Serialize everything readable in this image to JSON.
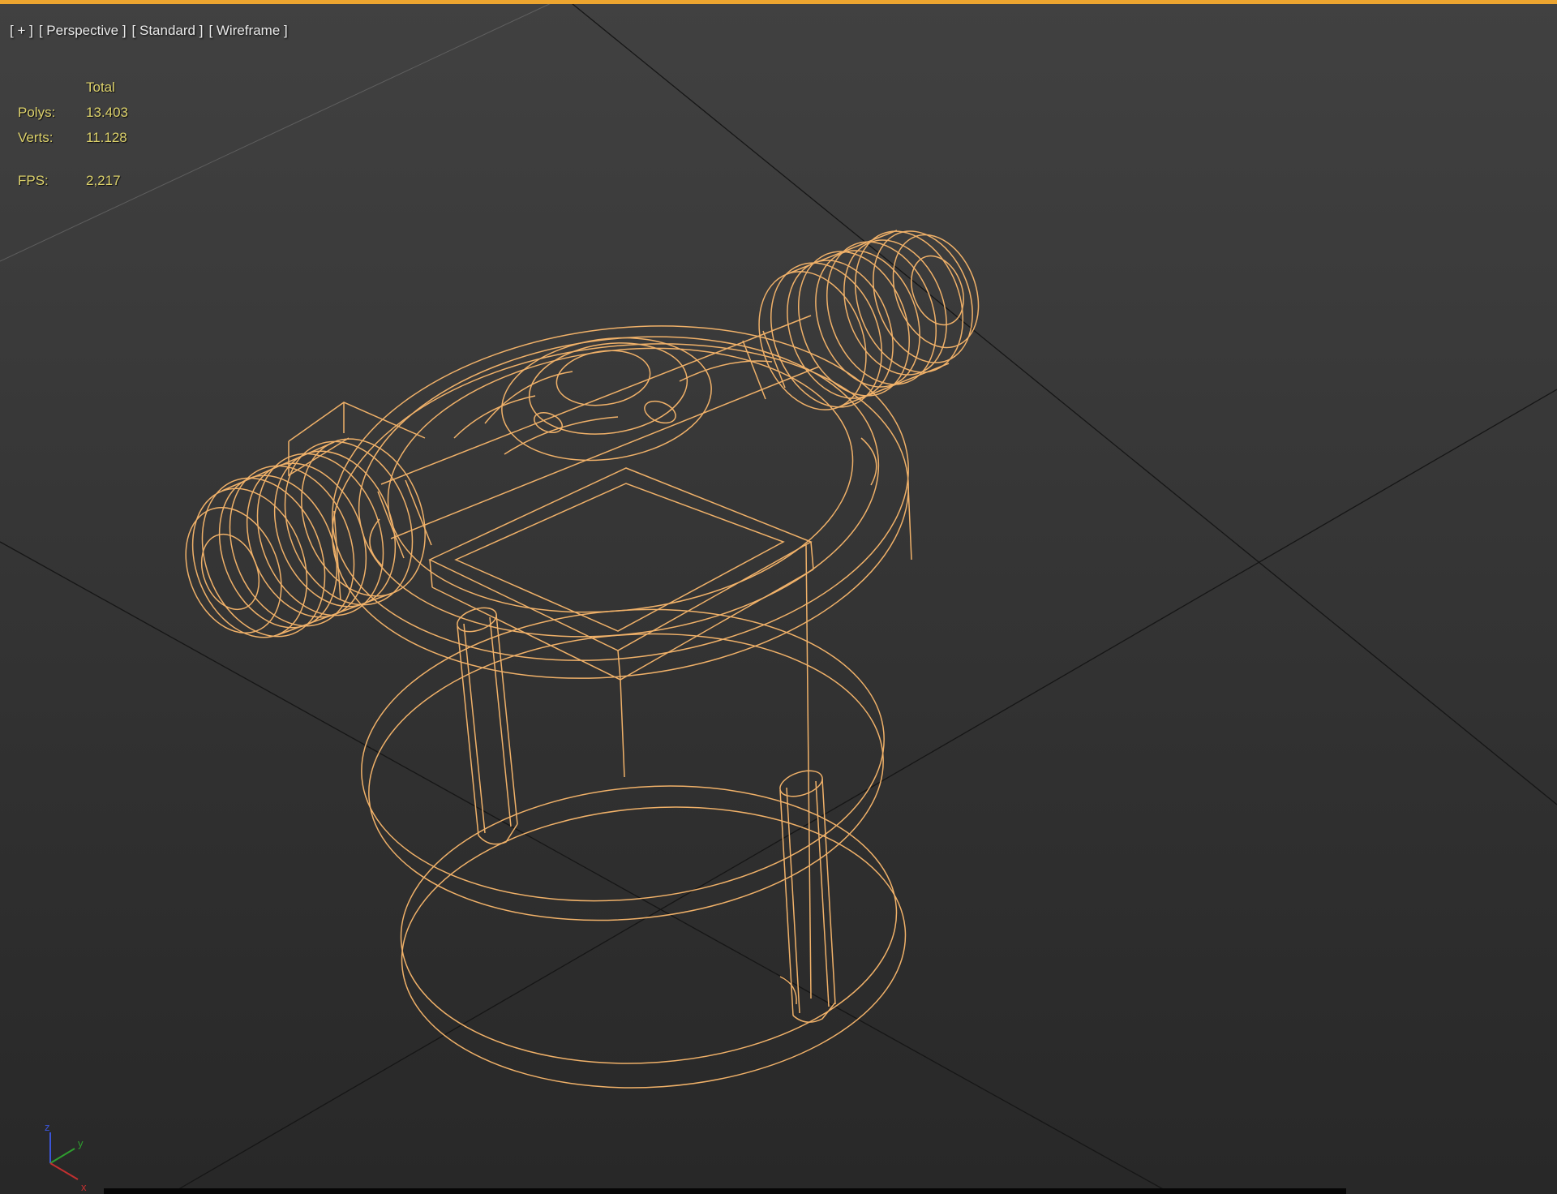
{
  "viewport": {
    "label": {
      "general": "[ + ]",
      "point_of_view": "[ Perspective ]",
      "render_preset": "[ Standard ]",
      "shading": "[ Wireframe ]"
    },
    "statistics": {
      "column_header": "Total",
      "rows": [
        {
          "label": "Polys:",
          "value": "13.403"
        },
        {
          "label": "Verts:",
          "value": "11.128"
        }
      ],
      "fps": {
        "label": "FPS:",
        "value": "2,217"
      }
    },
    "axis_tripod": {
      "x_label": "x",
      "y_label": "y",
      "z_label": "z"
    }
  },
  "colors": {
    "wireframe": "#F0B169",
    "viewport_active_border": "#EDA52F",
    "statistics_text": "#DCD16B",
    "viewport_label_text": "#E9E9E9",
    "grid_major_line": "#161616",
    "grid_minor_line": "#7A7A7A",
    "axis_x": "#C23030",
    "axis_y": "#2F9E2F",
    "axis_z": "#3B55D8",
    "background_top": "#414141",
    "background_bottom": "#282828"
  }
}
